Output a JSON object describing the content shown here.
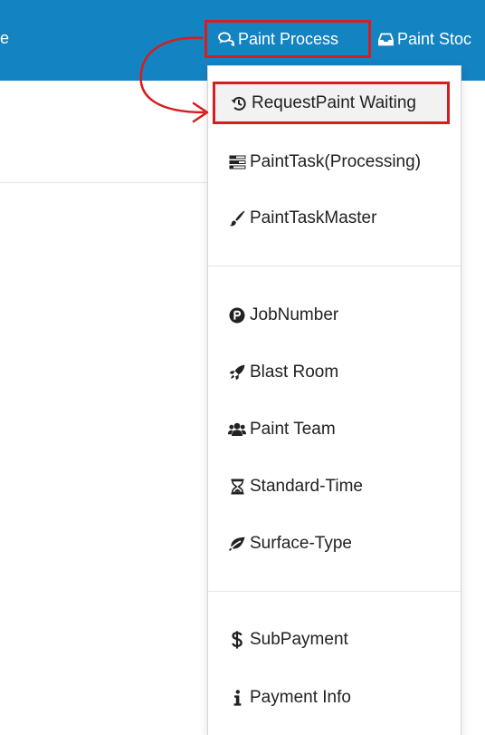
{
  "navbar": {
    "clipped_item_tail": "e",
    "items": [
      {
        "label": "Paint Process",
        "icon": "comments-icon",
        "highlighted": true
      },
      {
        "label": "Paint Stoc",
        "icon": "inbox-icon"
      }
    ]
  },
  "dropdown": {
    "items": [
      {
        "label": "RequestPaint Waiting",
        "icon": "history-icon",
        "active": true
      },
      {
        "label": "PaintTask(Processing)",
        "icon": "tasks-icon"
      },
      {
        "label": "PaintTaskMaster",
        "icon": "paint-brush-icon"
      },
      {
        "label": "JobNumber",
        "icon": "product-hunt-icon"
      },
      {
        "label": "Blast Room",
        "icon": "rocket-icon"
      },
      {
        "label": "Paint Team",
        "icon": "users-icon"
      },
      {
        "label": "Standard-Time",
        "icon": "hourglass-icon"
      },
      {
        "label": "Surface-Type",
        "icon": "leaf-icon"
      },
      {
        "label": "SubPayment",
        "icon": "dollar-icon"
      },
      {
        "label": "Payment Info",
        "icon": "info-icon"
      }
    ]
  },
  "colors": {
    "navbar_bg": "#1483c1",
    "highlight_red": "#d71d1d",
    "menu_text": "#222222"
  }
}
